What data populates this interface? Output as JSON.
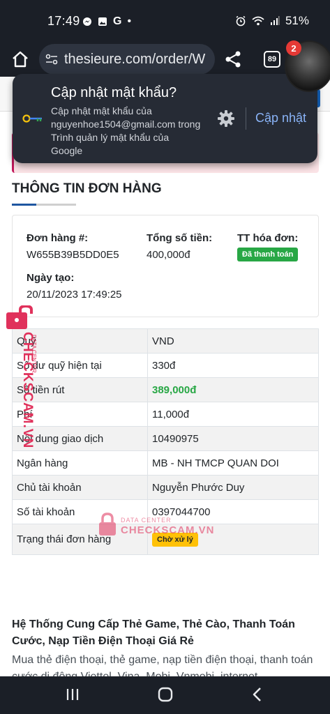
{
  "status_bar": {
    "time": "17:49",
    "left_glyphs": [
      "messenger-icon",
      "image-icon",
      "google-icon",
      "dot"
    ],
    "google_glyph": "G",
    "dot_glyph": "•",
    "battery": "51%"
  },
  "browser": {
    "url": "thesieure.com/order/W",
    "tab_count": "89",
    "notification_badge": "2"
  },
  "password_prompt": {
    "title": "Cập nhật mật khẩu?",
    "description": "Cập nhật mật khẩu của nguyenhoe1504@gmail.com trong Trình quản lý mật khẩu của Google",
    "update_label": "Cập nhật"
  },
  "order": {
    "section_title": "THÔNG TIN ĐƠN HÀNG",
    "order_id_label": "Đơn hàng #:",
    "order_id": "W655B39B5DD0E5",
    "total_label": "Tổng số tiền:",
    "total": "400,000đ",
    "invoice_label": "TT hóa đơn:",
    "invoice_status": "Đã thanh toán",
    "created_label": "Ngày tạo:",
    "created": "20/11/2023 17:49:25"
  },
  "details": {
    "rows": [
      {
        "key": "Quỹ",
        "value": "VND"
      },
      {
        "key": "Số dư quỹ hiện tại",
        "value": "330đ"
      },
      {
        "key": "Số tiền rút",
        "value": "389,000đ"
      },
      {
        "key": "Phí",
        "value": "11,000đ"
      },
      {
        "key": "Nội dung giao dịch",
        "value": "10490975"
      },
      {
        "key": "Ngân hàng",
        "value": "MB - NH TMCP QUAN DOI"
      },
      {
        "key": "Chủ tài khoản",
        "value": "Nguyễn Phước Duy"
      },
      {
        "key": "Số tài khoản",
        "value": "0397044700"
      },
      {
        "key": "Trạng thái đơn hàng",
        "value": "Chờ xử lý"
      }
    ]
  },
  "watermark": {
    "brand": "CHECKSCAM.VN",
    "sub": "DATA CENTER",
    "center_small": "DATA CENTER",
    "center_big": "CHECKSCAM.VN"
  },
  "footer": {
    "title": "Hệ Thống Cung Cấp Thẻ Game, Thẻ Cào, Thanh Toán Cước, Nạp Tiền Điện Thoại Giá Rẻ",
    "body": "Mua thẻ điện thoại, thẻ game, nạp tiền điện thoại, thanh toán cước di động Viettel, Vina, Mobi, Vnmobi, internet"
  },
  "colors": {
    "paid": "#28a745",
    "pending": "#ffc107",
    "link": "#8ab4f8",
    "watermark": "#e0315b"
  }
}
